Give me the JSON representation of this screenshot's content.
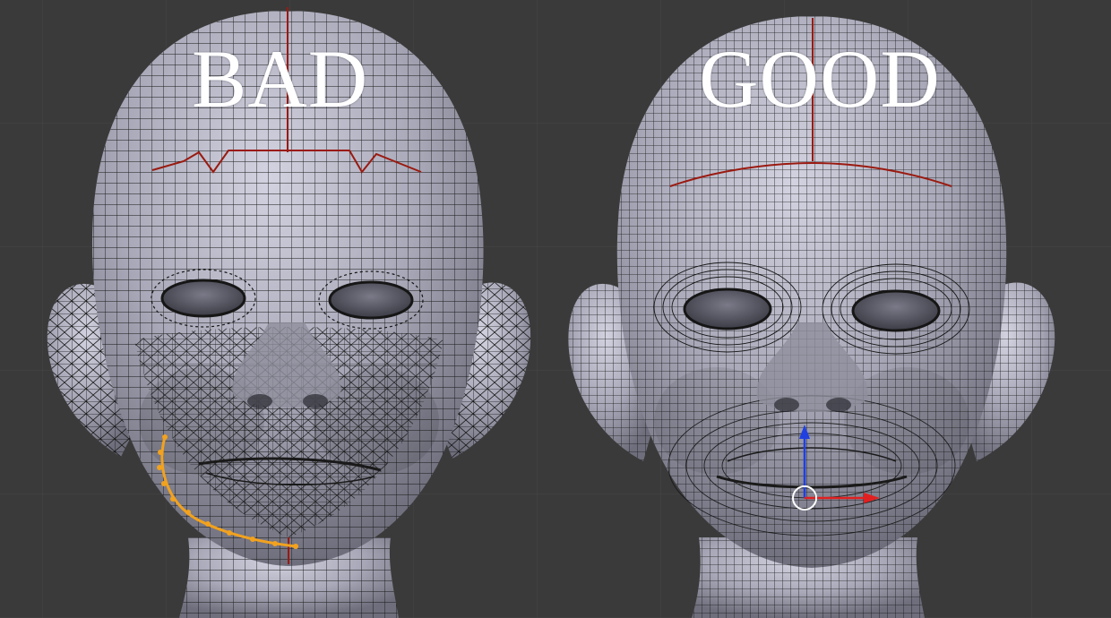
{
  "labels": {
    "bad": "BAD",
    "good": "GOOD"
  },
  "colors": {
    "background": "#3a3a3a",
    "grid": "#444444",
    "mesh_fill": "#a6a6b6",
    "wire": "#141414",
    "seam": "#9a1a10",
    "selection": "#f2a21e",
    "gizmo_x": "#e02020",
    "gizmo_z": "#2040e0"
  }
}
